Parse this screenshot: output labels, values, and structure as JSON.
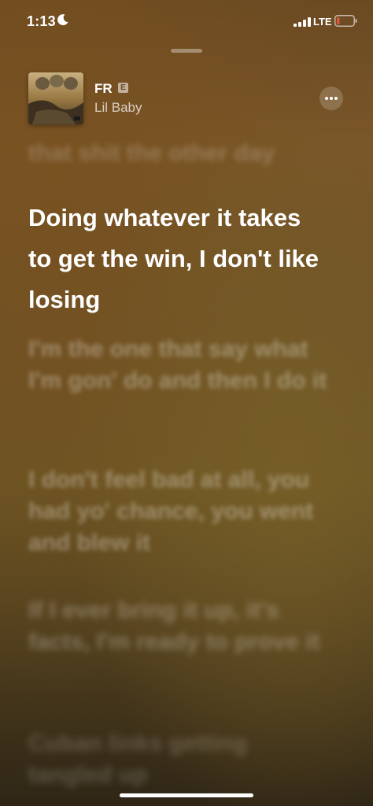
{
  "status_bar": {
    "time": "1:13",
    "network": "LTE",
    "icons": [
      "moon-icon",
      "signal-icon",
      "battery-icon"
    ]
  },
  "now_playing": {
    "title": "FR",
    "explicit_badge": "E",
    "artist": "Lil Baby"
  },
  "lyrics": {
    "previous_partial": "that shit the other day",
    "active": "Doing whatever it takes to get the win, I don't like losing",
    "upcoming": [
      "I'm the one that say what I'm gon' do and then I do it",
      "I don't feel bad at all, you had yo' chance, you went and blew it",
      "If I ever bring it up, it's facts, I'm ready to prove it",
      "Cuban links getting tangled up"
    ]
  },
  "colors": {
    "background_top": "#6b4a22",
    "background_bottom": "#2f2616",
    "battery_low": "#e0553c"
  }
}
